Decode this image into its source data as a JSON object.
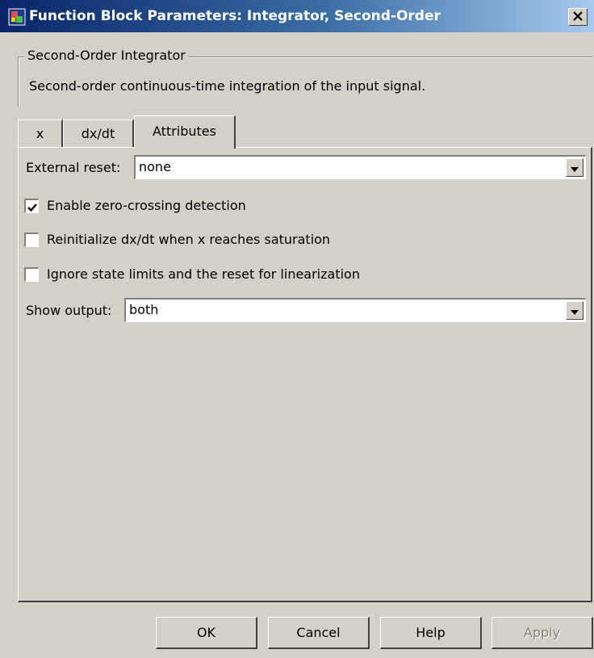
{
  "window": {
    "title": "Function Block Parameters: Integrator, Second-Order",
    "close_glyph": "✕",
    "app_icon": "simulink-block-icon"
  },
  "group": {
    "legend": "Second-Order Integrator",
    "description": "Second-order continuous-time integration of the input signal."
  },
  "tabs": [
    {
      "label": "x",
      "active": false
    },
    {
      "label": "dx/dt",
      "active": false
    },
    {
      "label": "Attributes",
      "active": true
    }
  ],
  "attributes": {
    "external_reset": {
      "label": "External reset:",
      "value": "none"
    },
    "checkboxes": [
      {
        "label": "Enable zero-crossing detection",
        "checked": true
      },
      {
        "label": "Reinitialize dx/dt when x reaches saturation",
        "checked": false
      },
      {
        "label": "Ignore state limits and the reset for linearization",
        "checked": false
      }
    ],
    "show_output": {
      "label": "Show output:",
      "value": "both"
    }
  },
  "buttons": {
    "ok": "OK",
    "cancel": "Cancel",
    "help": "Help",
    "apply": "Apply"
  },
  "colors": {
    "titlebar_start": "#0a246a",
    "titlebar_end": "#a6caf0",
    "face": "#d4d0c8"
  }
}
